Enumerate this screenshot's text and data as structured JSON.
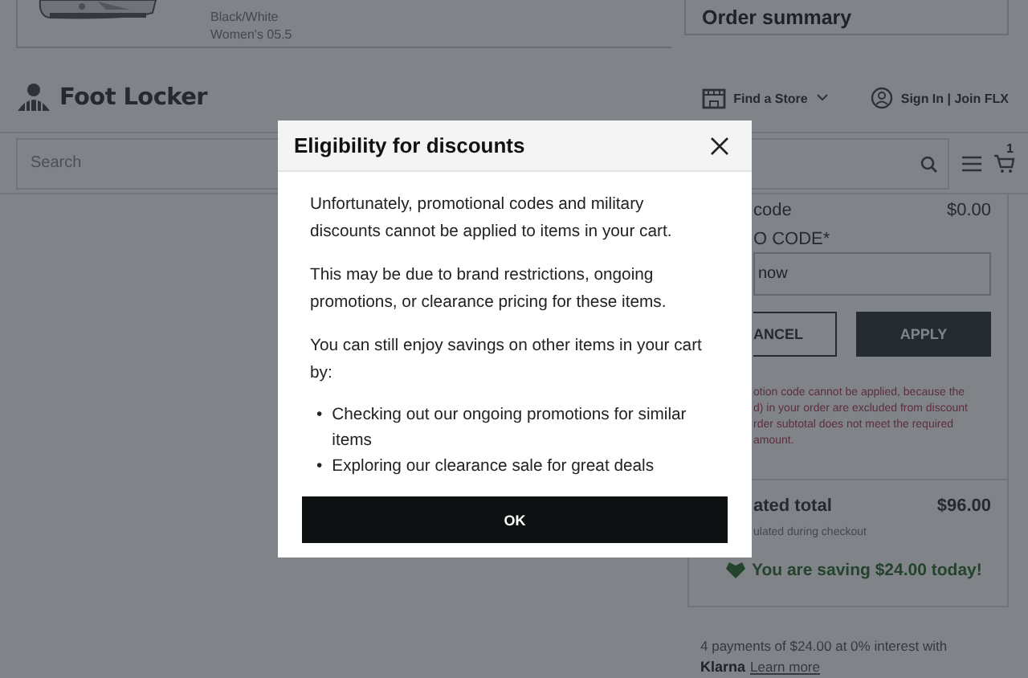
{
  "product": {
    "colorway": "Black/White",
    "size": "Women's 05.5"
  },
  "order_summary": {
    "title": "Order summary"
  },
  "header": {
    "logo": "Foot Locker",
    "find_store": "Find a Store",
    "sign_in": "Sign In | Join FLX"
  },
  "search": {
    "placeholder": "Search",
    "cart_count": "1"
  },
  "promo": {
    "row_label": "code",
    "row_value": "$0.00",
    "field_label": "O CODE*",
    "field_value": "now",
    "cancel": "ANCEL",
    "apply": "APPLY",
    "error_lines": [
      "otion code cannot be applied, because the",
      "d) in your order are excluded from discount",
      "rder subtotal does not meet the required",
      "amount."
    ]
  },
  "total": {
    "label": "ated total",
    "value": "$96.00",
    "note": "ulated during checkout"
  },
  "saving": "You are saving $24.00 today!",
  "klarna": {
    "text": "4 payments of $24.00 at 0% interest with",
    "brand": "Klarna",
    "link": "Learn more"
  },
  "dialog": {
    "title": "Eligibility for discounts",
    "paragraphs": [
      "Unfortunately, promotional codes and military discounts cannot be applied to items in your cart.",
      "This may be due to brand restrictions, ongoing promotions, or clearance pricing for these items.",
      "You can still enjoy savings on other items in your cart by:"
    ],
    "bullets": [
      {
        "marker": "•",
        "text": "Checking out our ongoing promotions for similar items"
      },
      {
        "marker": "•",
        "text": "Exploring our clearance sale for great deals"
      }
    ],
    "button": "OK"
  }
}
